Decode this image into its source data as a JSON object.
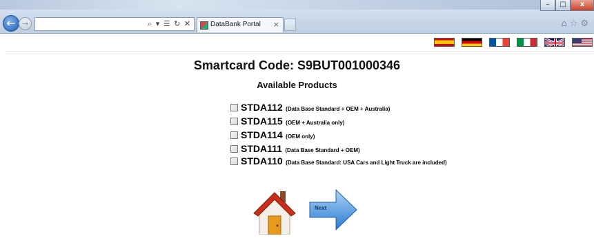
{
  "browser": {
    "address_tools": "⌕ ▾ ☰ ↻ ✕",
    "tab_title": "DataBank Portal",
    "tab_close": "×",
    "window_buttons": [
      "–",
      "□",
      "x"
    ],
    "right_icons": "⌂☆⚙",
    "back_icon": "←",
    "forward_icon": "→"
  },
  "languages": [
    "spain-flag-icon",
    "germany-flag-icon",
    "france-flag-icon",
    "italy-flag-icon",
    "uk-flag-icon",
    "usa-flag-icon"
  ],
  "page": {
    "smartcard_title": "Smartcard Code: S9BUT001000346",
    "products_title": "Available Products"
  },
  "products": [
    {
      "code": "STDA112",
      "description": "(Data Base Standard + OEM + Australia)"
    },
    {
      "code": "STDA115",
      "description": "(OEM + Australia only)"
    },
    {
      "code": "STDA114",
      "description": "(OEM only)"
    },
    {
      "code": "STDA111",
      "description": "(Data Base Standard + OEM)"
    },
    {
      "code": "STDA110",
      "description": "(Data Base Standard: USA Cars and Light Truck are included)"
    }
  ],
  "buttons": {
    "next_label": "Next"
  }
}
